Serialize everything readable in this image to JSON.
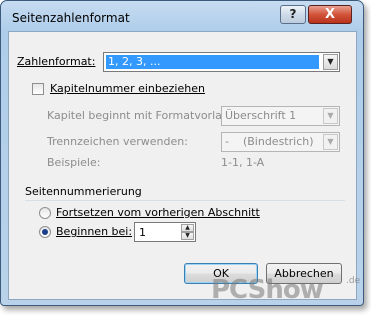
{
  "window": {
    "title": "Seitenzahlenformat",
    "help_label": "?",
    "close_label": "X"
  },
  "number_format": {
    "label": "Zahlenformat:",
    "label_hotkey": "Z",
    "value": "1, 2, 3, ..."
  },
  "chapter": {
    "checkbox_label": "Kapitelnummer einbeziehen",
    "checkbox_hotkey": "K",
    "checked": false,
    "style_label": "Kapitel beginnt mit Formatvorlage:",
    "style_value": "Überschrift 1",
    "separator_label": "Trennzeichen verwenden:",
    "separator_value": "-    (Bindestrich)",
    "examples_label": "Beispiele:",
    "examples_value": "1-1, 1-A"
  },
  "numbering": {
    "group_label": "Seitennummerierung",
    "continue_label": "Fortsetzen vom vorherigen Abschnitt",
    "continue_hotkey": "F",
    "start_label": "Beginnen bei:",
    "start_hotkey": "B",
    "selected": "start",
    "start_value": "1"
  },
  "buttons": {
    "ok": "OK",
    "cancel": "Abbrechen"
  },
  "watermark": {
    "text": "PCShow",
    "suffix": ".de"
  },
  "icons": {
    "dropdown": "chevron-down-icon",
    "spin_up": "chevron-up-icon",
    "spin_down": "chevron-down-icon"
  }
}
